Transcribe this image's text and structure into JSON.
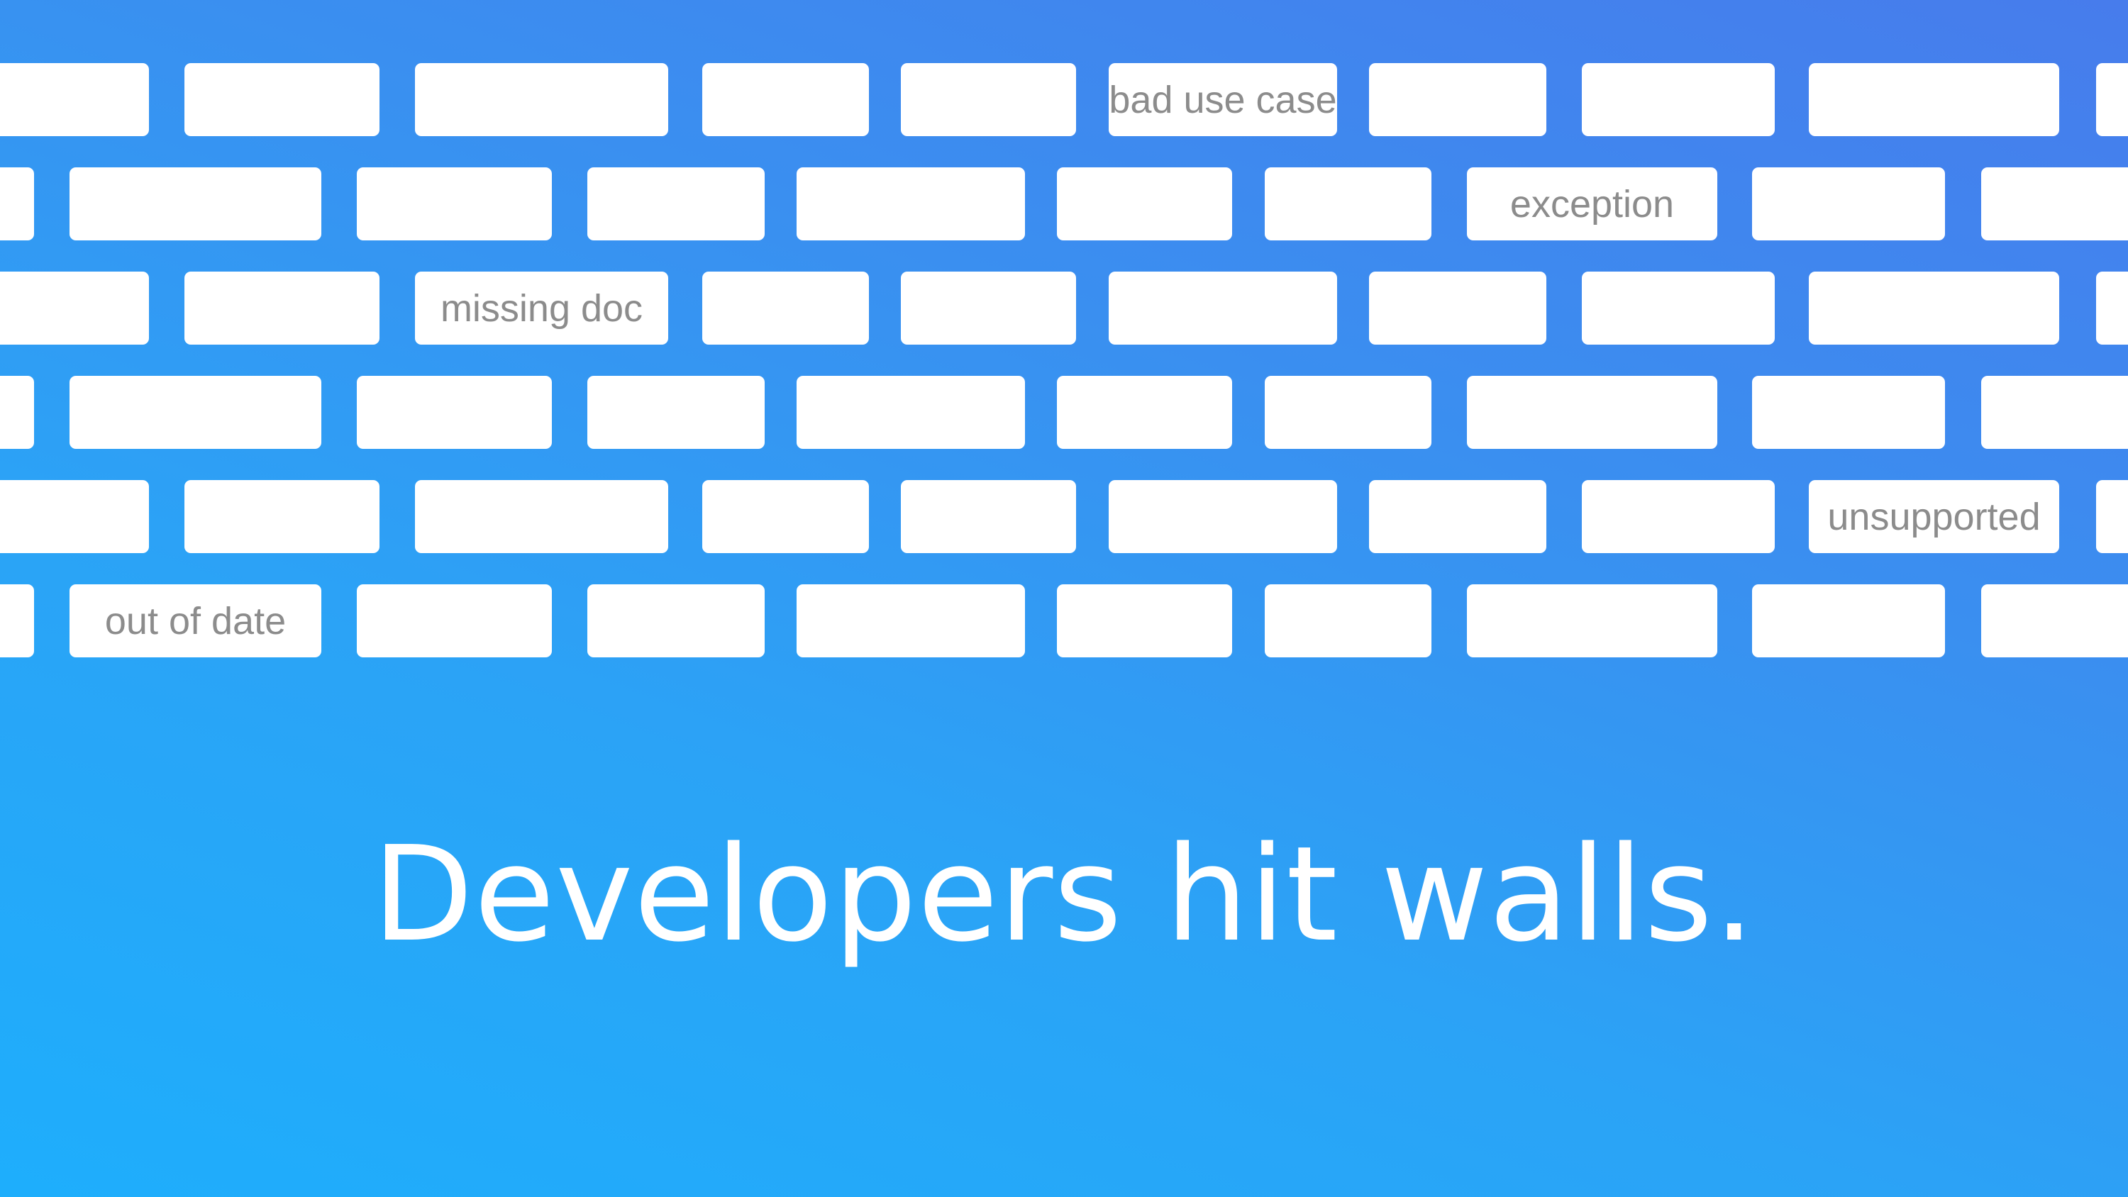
{
  "wall": {
    "brick_labels": {
      "bad_use_case": "bad use case",
      "exception": "exception",
      "missing_doc": "missing doc",
      "unsupported": "unsupported",
      "out_of_date": "out of date"
    }
  },
  "headline": "Developers hit walls.",
  "colors": {
    "brick": "#ffffff",
    "brick_text": "#8c8c8c",
    "gradient_top": "#477cec",
    "gradient_bottom": "#1eaefc",
    "headline_text": "#ffffff"
  }
}
